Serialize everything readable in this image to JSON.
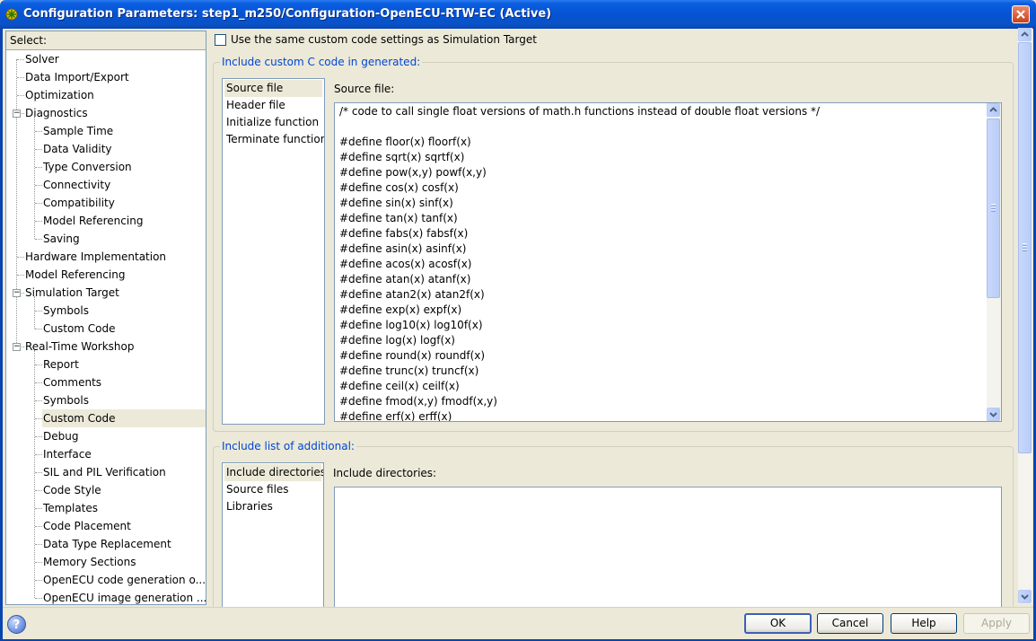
{
  "window": {
    "title": "Configuration Parameters: step1_m250/Configuration-OpenECU-RTW-EC (Active)"
  },
  "tree": {
    "header": "Select:",
    "items": [
      {
        "label": "Solver",
        "level": 1
      },
      {
        "label": "Data Import/Export",
        "level": 1
      },
      {
        "label": "Optimization",
        "level": 1
      },
      {
        "label": "Diagnostics",
        "level": 1,
        "expanded": true
      },
      {
        "label": "Sample Time",
        "level": 2
      },
      {
        "label": "Data Validity",
        "level": 2
      },
      {
        "label": "Type Conversion",
        "level": 2
      },
      {
        "label": "Connectivity",
        "level": 2
      },
      {
        "label": "Compatibility",
        "level": 2
      },
      {
        "label": "Model Referencing",
        "level": 2
      },
      {
        "label": "Saving",
        "level": 2
      },
      {
        "label": "Hardware Implementation",
        "level": 1
      },
      {
        "label": "Model Referencing",
        "level": 1
      },
      {
        "label": "Simulation Target",
        "level": 1,
        "expanded": true
      },
      {
        "label": "Symbols",
        "level": 2
      },
      {
        "label": "Custom Code",
        "level": 2
      },
      {
        "label": "Real-Time Workshop",
        "level": 1,
        "expanded": true
      },
      {
        "label": "Report",
        "level": 2
      },
      {
        "label": "Comments",
        "level": 2
      },
      {
        "label": "Symbols",
        "level": 2
      },
      {
        "label": "Custom Code",
        "level": 2,
        "selected": true
      },
      {
        "label": "Debug",
        "level": 2
      },
      {
        "label": "Interface",
        "level": 2
      },
      {
        "label": "SIL and PIL Verification",
        "level": 2
      },
      {
        "label": "Code Style",
        "level": 2
      },
      {
        "label": "Templates",
        "level": 2
      },
      {
        "label": "Code Placement",
        "level": 2
      },
      {
        "label": "Data Type Replacement",
        "level": 2
      },
      {
        "label": "Memory Sections",
        "level": 2
      },
      {
        "label": "OpenECU code generation o...",
        "level": 2
      },
      {
        "label": "OpenECU image generation ...",
        "level": 2
      }
    ]
  },
  "options": {
    "same_settings_label": "Use the same custom code settings as Simulation Target",
    "same_settings_checked": false
  },
  "custom_code_group": {
    "title": "Include custom C code in generated:",
    "items": [
      "Source file",
      "Header file",
      "Initialize function",
      "Terminate function"
    ],
    "selected_index": 0,
    "editor_label": "Source file:",
    "code_lines": [
      "/* code to call single float versions of math.h functions instead of double float versions */",
      "",
      "#define floor(x) floorf(x)",
      "#define sqrt(x) sqrtf(x)",
      "#define pow(x,y) powf(x,y)",
      "#define cos(x) cosf(x)",
      "#define sin(x) sinf(x)",
      "#define tan(x) tanf(x)",
      "#define fabs(x) fabsf(x)",
      "#define asin(x) asinf(x)",
      "#define acos(x) acosf(x)",
      "#define atan(x) atanf(x)",
      "#define atan2(x) atan2f(x)",
      "#define exp(x) expf(x)",
      "#define log10(x) log10f(x)",
      "#define log(x) logf(x)",
      "#define round(x) roundf(x)",
      "#define trunc(x) truncf(x)",
      "#define ceil(x) ceilf(x)",
      "#define fmod(x,y) fmodf(x,y)",
      "#define erf(x) erff(x)"
    ]
  },
  "include_group": {
    "title": "Include list of additional:",
    "items": [
      "Include directories",
      "Source files",
      "Libraries"
    ],
    "selected_index": 0,
    "editor_label": "Include directories:",
    "editor_value": ""
  },
  "buttons": {
    "ok": "OK",
    "cancel": "Cancel",
    "help": "Help",
    "apply": "Apply",
    "help_icon": "?"
  }
}
